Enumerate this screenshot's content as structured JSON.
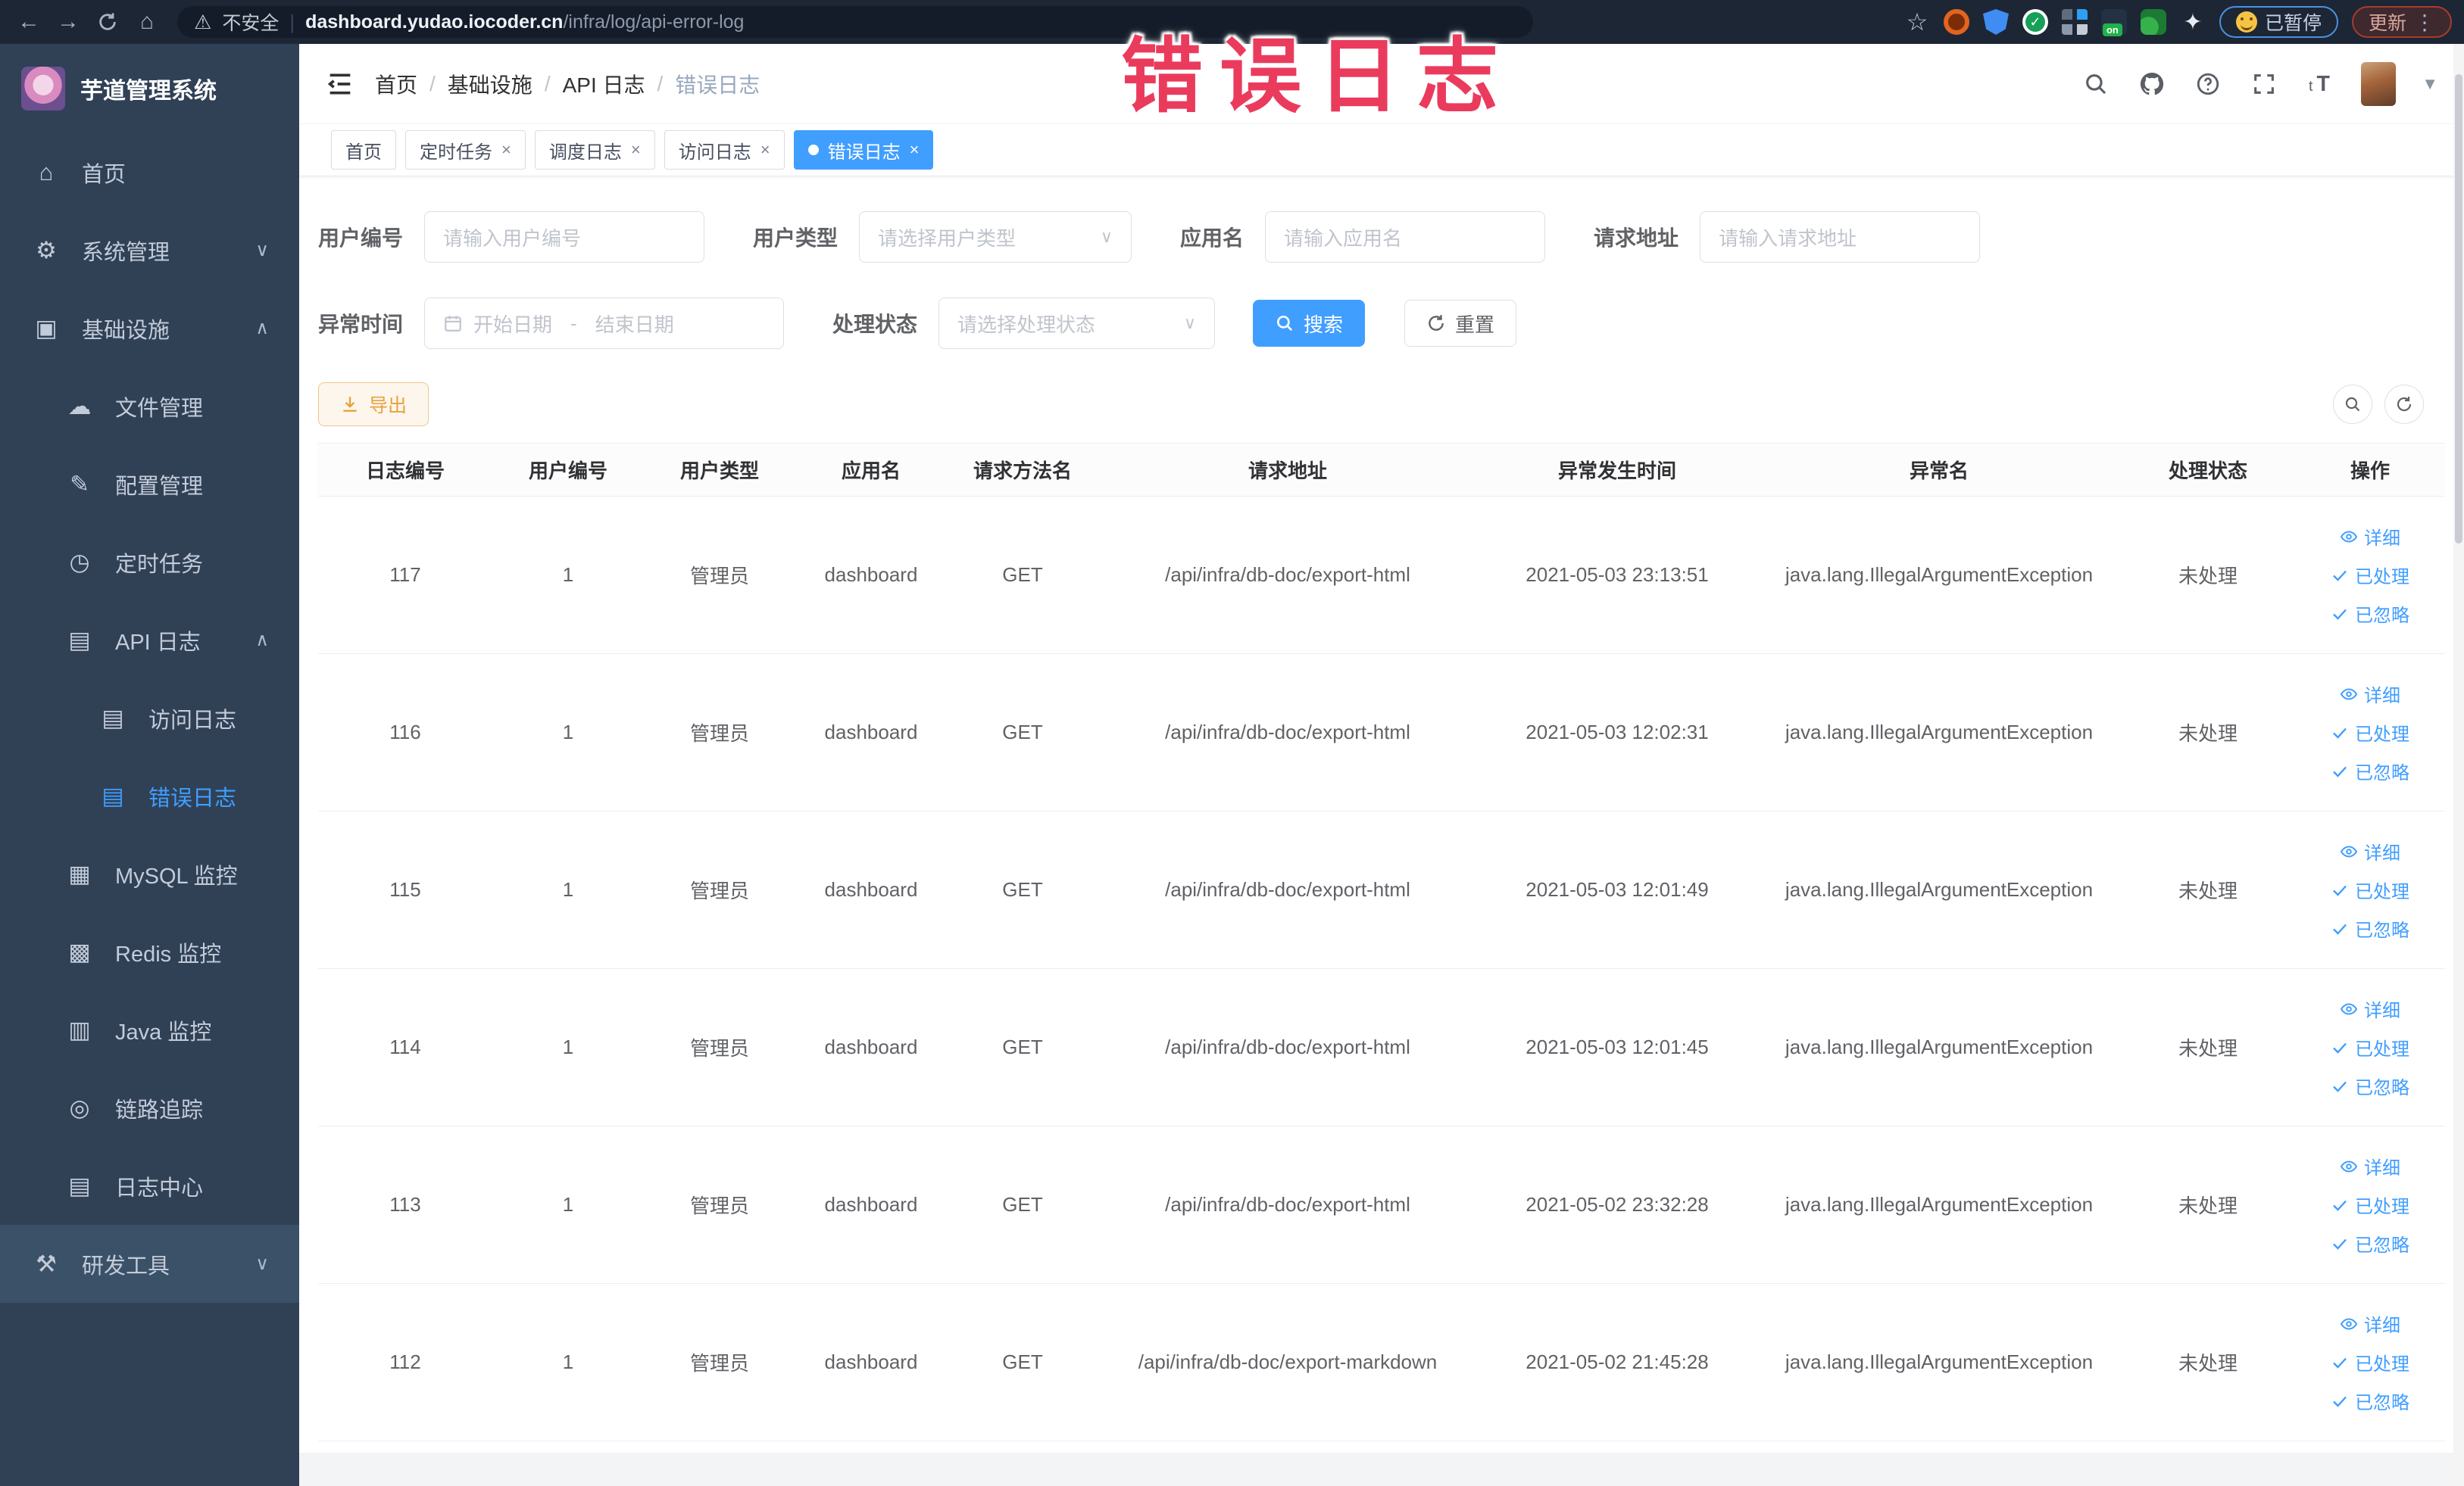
{
  "browser": {
    "security": "不安全",
    "url_host": "dashboard.yudao.iocoder.cn",
    "url_path": "/infra/log/api-error-log",
    "paused": "已暂停",
    "update": "更新",
    "extension_icons": [
      "bookmark-star-icon",
      "extension-orange-icon",
      "extension-shield-icon",
      "extension-v-icon",
      "extension-grid-icon",
      "extension-on-badge-icon",
      "extension-leaf-icon",
      "extension-puzzle-icon"
    ]
  },
  "overlay_text": "错误日志",
  "sidebar": {
    "logo_title": "芋道管理系统",
    "items": [
      {
        "key": "home",
        "label": "首页",
        "icon": "home-icon",
        "depth": 0
      },
      {
        "key": "system",
        "label": "系统管理",
        "icon": "gear-icon",
        "depth": 0,
        "chevron": "down"
      },
      {
        "key": "infra",
        "label": "基础设施",
        "icon": "infra-icon",
        "depth": 0,
        "chevron": "up"
      },
      {
        "key": "file",
        "label": "文件管理",
        "icon": "cloud-upload-icon",
        "depth": 1
      },
      {
        "key": "config",
        "label": "配置管理",
        "icon": "edit-icon",
        "depth": 1
      },
      {
        "key": "job",
        "label": "定时任务",
        "icon": "timer-icon",
        "depth": 1
      },
      {
        "key": "api-log",
        "label": "API 日志",
        "icon": "document-icon",
        "depth": 1,
        "chevron": "up"
      },
      {
        "key": "access-log",
        "label": "访问日志",
        "icon": "document-icon",
        "depth": 2
      },
      {
        "key": "error-log",
        "label": "错误日志",
        "icon": "document-icon",
        "depth": 2,
        "active": true
      },
      {
        "key": "mysql",
        "label": "MySQL 监控",
        "icon": "chart-icon",
        "depth": 1
      },
      {
        "key": "redis",
        "label": "Redis 监控",
        "icon": "database-icon",
        "depth": 1
      },
      {
        "key": "java",
        "label": "Java 监控",
        "icon": "monitor-icon",
        "depth": 1
      },
      {
        "key": "trace",
        "label": "链路追踪",
        "icon": "eye-icon",
        "depth": 1
      },
      {
        "key": "log-center",
        "label": "日志中心",
        "icon": "document-icon",
        "depth": 1
      },
      {
        "key": "dev-tools",
        "label": "研发工具",
        "icon": "tools-icon",
        "depth": 0,
        "chevron": "down",
        "section": true
      }
    ]
  },
  "breadcrumb": [
    "首页",
    "基础设施",
    "API 日志",
    "错误日志"
  ],
  "tabs": [
    {
      "label": "首页",
      "closable": false,
      "active": false
    },
    {
      "label": "定时任务",
      "closable": true,
      "active": false
    },
    {
      "label": "调度日志",
      "closable": true,
      "active": false
    },
    {
      "label": "访问日志",
      "closable": true,
      "active": false
    },
    {
      "label": "错误日志",
      "closable": true,
      "active": true
    }
  ],
  "filters": {
    "user_id": {
      "label": "用户编号",
      "placeholder": "请输入用户编号"
    },
    "user_type": {
      "label": "用户类型",
      "placeholder": "请选择用户类型"
    },
    "app_name": {
      "label": "应用名",
      "placeholder": "请输入应用名"
    },
    "request_url": {
      "label": "请求地址",
      "placeholder": "请输入请求地址"
    },
    "exception_time": {
      "label": "异常时间",
      "start_placeholder": "开始日期",
      "separator": "-",
      "end_placeholder": "结束日期"
    },
    "process_status": {
      "label": "处理状态",
      "placeholder": "请选择处理状态"
    },
    "search_label": "搜索",
    "reset_label": "重置"
  },
  "toolbar": {
    "export_label": "导出"
  },
  "table": {
    "columns": [
      "日志编号",
      "用户编号",
      "用户类型",
      "应用名",
      "请求方法名",
      "请求地址",
      "异常发生时间",
      "异常名",
      "处理状态",
      "操作"
    ],
    "action_labels": {
      "detail": "详细",
      "processed": "已处理",
      "ignored": "已忽略"
    },
    "rows": [
      {
        "id": "117",
        "user_id": "1",
        "user_type": "管理员",
        "app": "dashboard",
        "method": "GET",
        "url": "/api/infra/db-doc/export-html",
        "time": "2021-05-03 23:13:51",
        "exception": "java.lang.IllegalArgumentException",
        "status": "未处理"
      },
      {
        "id": "116",
        "user_id": "1",
        "user_type": "管理员",
        "app": "dashboard",
        "method": "GET",
        "url": "/api/infra/db-doc/export-html",
        "time": "2021-05-03 12:02:31",
        "exception": "java.lang.IllegalArgumentException",
        "status": "未处理"
      },
      {
        "id": "115",
        "user_id": "1",
        "user_type": "管理员",
        "app": "dashboard",
        "method": "GET",
        "url": "/api/infra/db-doc/export-html",
        "time": "2021-05-03 12:01:49",
        "exception": "java.lang.IllegalArgumentException",
        "status": "未处理"
      },
      {
        "id": "114",
        "user_id": "1",
        "user_type": "管理员",
        "app": "dashboard",
        "method": "GET",
        "url": "/api/infra/db-doc/export-html",
        "time": "2021-05-03 12:01:45",
        "exception": "java.lang.IllegalArgumentException",
        "status": "未处理"
      },
      {
        "id": "113",
        "user_id": "1",
        "user_type": "管理员",
        "app": "dashboard",
        "method": "GET",
        "url": "/api/infra/db-doc/export-html",
        "time": "2021-05-02 23:32:28",
        "exception": "java.lang.IllegalArgumentException",
        "status": "未处理"
      },
      {
        "id": "112",
        "user_id": "1",
        "user_type": "管理员",
        "app": "dashboard",
        "method": "GET",
        "url": "/api/infra/db-doc/export-markdown",
        "time": "2021-05-02 21:45:28",
        "exception": "java.lang.IllegalArgumentException",
        "status": "未处理"
      }
    ]
  },
  "colors": {
    "accent": "#409eff",
    "warning": "#e6a23c",
    "sidebar_bg": "#304156",
    "overlay_pink": "#ea3b5d"
  }
}
